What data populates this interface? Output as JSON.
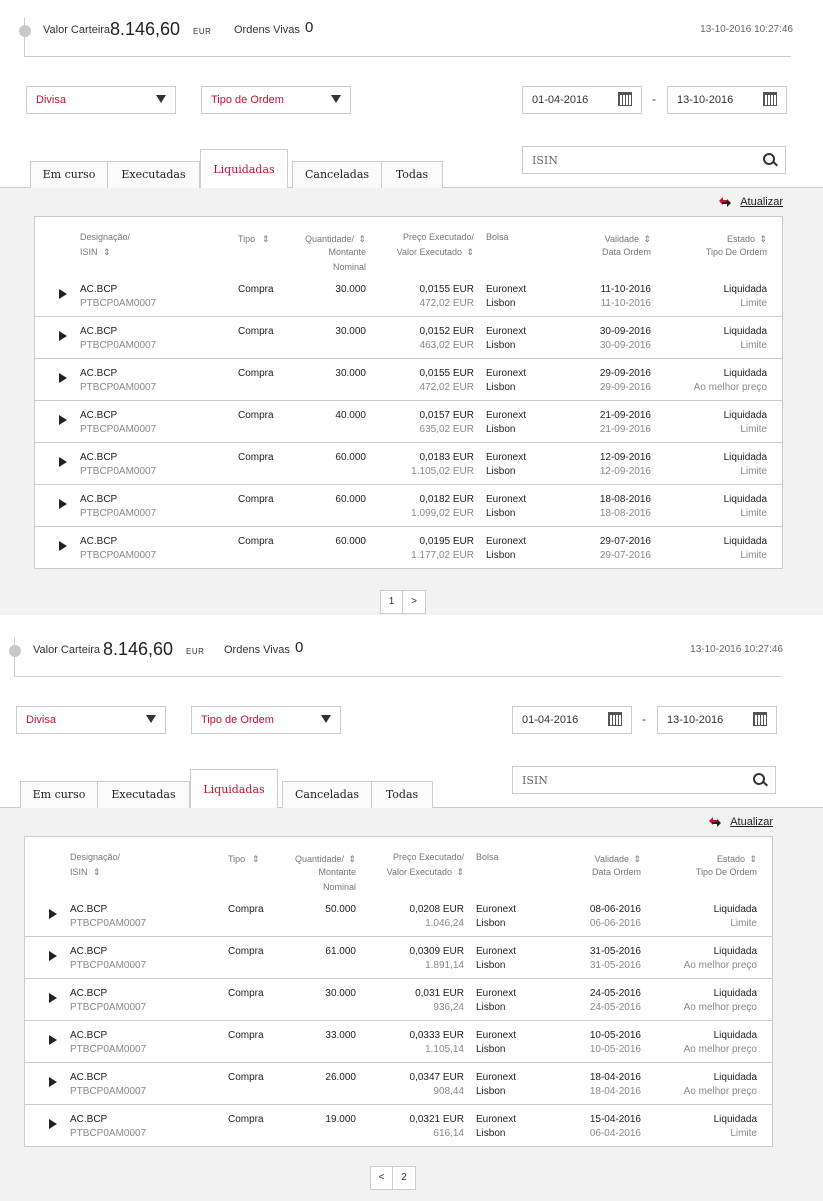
{
  "header": {
    "valor_label": "Valor Carteira",
    "valor_value": "8.146,60",
    "currency": "EUR",
    "ordens_label": "Ordens Vivas",
    "ordens_value": "0",
    "timestamp": "13-10-2016 10:27:46"
  },
  "filters": {
    "divisa": "Divisa",
    "tipo_ordem": "Tipo de Ordem",
    "date_from": "01-04-2016",
    "date_sep": "-",
    "date_to": "13-10-2016",
    "isin_placeholder": "ISIN"
  },
  "tabs": [
    "Em curso",
    "Executadas",
    "Liquidadas",
    "Canceladas",
    "Todas"
  ],
  "refresh_label": "Atualizar",
  "columns": {
    "designacao": "Designação/",
    "isin": "ISIN",
    "tipo": "Tipo",
    "quantidade": "Quantidade/",
    "montante": "Montante",
    "nominal": "Nominal",
    "preco": "Preço Executado/",
    "valor": "Valor Executado",
    "bolsa": "Bolsa",
    "validade": "Validade",
    "data_ordem": "Data Ordem",
    "estado": "Estado",
    "tipo_de_ordem": "Tipo De Ordem",
    "sort_glyph": "⇕"
  },
  "page1": {
    "rows": [
      {
        "name": "AC.BCP",
        "isin": "PTBCP0AM0007",
        "tipo": "Compra",
        "qty": "30.000",
        "preco": "0,0155 EUR",
        "valor": "472,02 EUR",
        "bolsa": "Euronext",
        "city": "Lisbon",
        "validade": "11-10-2016",
        "data": "11-10-2016",
        "estado": "Liquidada",
        "ordem": "Limite"
      },
      {
        "name": "AC.BCP",
        "isin": "PTBCP0AM0007",
        "tipo": "Compra",
        "qty": "30.000",
        "preco": "0,0152 EUR",
        "valor": "463,02 EUR",
        "bolsa": "Euronext",
        "city": "Lisbon",
        "validade": "30-09-2016",
        "data": "30-09-2016",
        "estado": "Liquidada",
        "ordem": "Limite"
      },
      {
        "name": "AC.BCP",
        "isin": "PTBCP0AM0007",
        "tipo": "Compra",
        "qty": "30.000",
        "preco": "0,0155 EUR",
        "valor": "472,02 EUR",
        "bolsa": "Euronext",
        "city": "Lisbon",
        "validade": "29-09-2016",
        "data": "29-09-2016",
        "estado": "Liquidada",
        "ordem": "Ao melhor preço"
      },
      {
        "name": "AC.BCP",
        "isin": "PTBCP0AM0007",
        "tipo": "Compra",
        "qty": "40.000",
        "preco": "0,0157 EUR",
        "valor": "635,02 EUR",
        "bolsa": "Euronext",
        "city": "Lisbon",
        "validade": "21-09-2016",
        "data": "21-09-2016",
        "estado": "Liquidada",
        "ordem": "Limite"
      },
      {
        "name": "AC.BCP",
        "isin": "PTBCP0AM0007",
        "tipo": "Compra",
        "qty": "60.000",
        "preco": "0,0183 EUR",
        "valor": "1.105,02 EUR",
        "bolsa": "Euronext",
        "city": "Lisbon",
        "validade": "12-09-2016",
        "data": "12-09-2016",
        "estado": "Liquidada",
        "ordem": "Limite"
      },
      {
        "name": "AC.BCP",
        "isin": "PTBCP0AM0007",
        "tipo": "Compra",
        "qty": "60.000",
        "preco": "0,0182 EUR",
        "valor": "1.099,02 EUR",
        "bolsa": "Euronext",
        "city": "Lisbon",
        "validade": "18-08-2016",
        "data": "18-08-2016",
        "estado": "Liquidada",
        "ordem": "Limite"
      },
      {
        "name": "AC.BCP",
        "isin": "PTBCP0AM0007",
        "tipo": "Compra",
        "qty": "60.000",
        "preco": "0,0195 EUR",
        "valor": "1.177,02 EUR",
        "bolsa": "Euronext",
        "city": "Lisbon",
        "validade": "29-07-2016",
        "data": "29-07-2016",
        "estado": "Liquidada",
        "ordem": "Limite"
      }
    ],
    "pager": [
      "1",
      ">"
    ]
  },
  "page2": {
    "rows": [
      {
        "name": "AC.BCP",
        "isin": "PTBCP0AM0007",
        "tipo": "Compra",
        "qty": "50.000",
        "preco": "0,0208 EUR",
        "valor": "1.046,24",
        "bolsa": "Euronext",
        "city": "Lisbon",
        "validade": "08-06-2016",
        "data": "06-06-2016",
        "estado": "Liquidada",
        "ordem": "Limite"
      },
      {
        "name": "AC.BCP",
        "isin": "PTBCP0AM0007",
        "tipo": "Compra",
        "qty": "61.000",
        "preco": "0,0309 EUR",
        "valor": "1.891,14",
        "bolsa": "Euronext",
        "city": "Lisbon",
        "validade": "31-05-2016",
        "data": "31-05-2016",
        "estado": "Liquidada",
        "ordem": "Ao melhor preço"
      },
      {
        "name": "AC.BCP",
        "isin": "PTBCP0AM0007",
        "tipo": "Compra",
        "qty": "30.000",
        "preco": "0,031 EUR",
        "valor": "936,24",
        "bolsa": "Euronext",
        "city": "Lisbon",
        "validade": "24-05-2016",
        "data": "24-05-2016",
        "estado": "Liquidada",
        "ordem": "Ao melhor preço"
      },
      {
        "name": "AC.BCP",
        "isin": "PTBCP0AM0007",
        "tipo": "Compra",
        "qty": "33.000",
        "preco": "0,0333 EUR",
        "valor": "1.105,14",
        "bolsa": "Euronext",
        "city": "Lisbon",
        "validade": "10-05-2016",
        "data": "10-05-2016",
        "estado": "Liquidada",
        "ordem": "Ao melhor preço"
      },
      {
        "name": "AC.BCP",
        "isin": "PTBCP0AM0007",
        "tipo": "Compra",
        "qty": "26.000",
        "preco": "0,0347 EUR",
        "valor": "908,44",
        "bolsa": "Euronext",
        "city": "Lisbon",
        "validade": "18-04-2016",
        "data": "18-04-2016",
        "estado": "Liquidada",
        "ordem": "Ao melhor preço"
      },
      {
        "name": "AC.BCP",
        "isin": "PTBCP0AM0007",
        "tipo": "Compra",
        "qty": "19.000",
        "preco": "0,0321 EUR",
        "valor": "616,14",
        "bolsa": "Euronext",
        "city": "Lisbon",
        "validade": "15-04-2016",
        "data": "06-04-2016",
        "estado": "Liquidada",
        "ordem": "Limite"
      }
    ],
    "pager": [
      "<",
      "2"
    ]
  },
  "colors": {
    "accent": "#c8102e",
    "border": "#cccccc",
    "band": "#f2f2f2"
  }
}
